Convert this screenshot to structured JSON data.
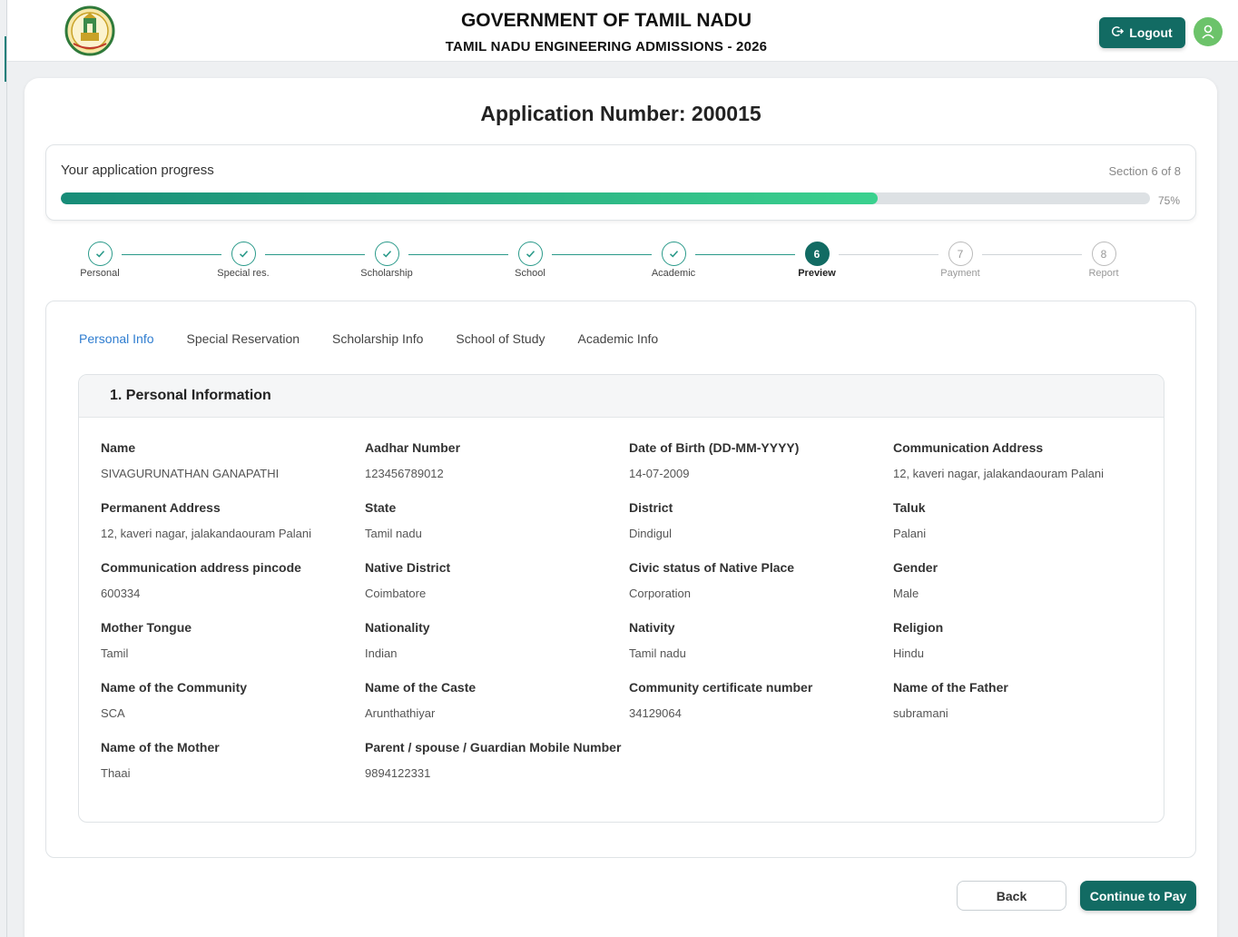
{
  "header": {
    "title": "GOVERNMENT OF TAMIL NADU",
    "subtitle": "TAMIL NADU ENGINEERING ADMISSIONS - 2026",
    "logout_label": "Logout"
  },
  "application": {
    "number_text": "Application Number: 200015"
  },
  "progress": {
    "label": "Your application progress",
    "section_text": "Section 6 of 8",
    "percent_text": "75%",
    "fraction": 0.75
  },
  "steps": [
    {
      "num": "1",
      "label": "Personal",
      "status": "done"
    },
    {
      "num": "2",
      "label": "Special res.",
      "status": "done"
    },
    {
      "num": "3",
      "label": "Scholarship",
      "status": "done"
    },
    {
      "num": "4",
      "label": "School",
      "status": "done"
    },
    {
      "num": "5",
      "label": "Academic",
      "status": "done"
    },
    {
      "num": "6",
      "label": "Preview",
      "status": "current"
    },
    {
      "num": "7",
      "label": "Payment",
      "status": "pending"
    },
    {
      "num": "8",
      "label": "Report",
      "status": "pending"
    }
  ],
  "tabs": [
    {
      "label": "Personal Info",
      "active": true
    },
    {
      "label": "Special Reservation",
      "active": false
    },
    {
      "label": "Scholarship Info",
      "active": false
    },
    {
      "label": "School of Study",
      "active": false
    },
    {
      "label": "Academic Info",
      "active": false
    }
  ],
  "section": {
    "title": "1. Personal Information",
    "fields": [
      {
        "label": "Name",
        "value": "SIVAGURUNATHAN GANAPATHI"
      },
      {
        "label": "Aadhar Number",
        "value": "123456789012"
      },
      {
        "label": "Date of Birth (DD-MM-YYYY)",
        "value": "14-07-2009"
      },
      {
        "label": "Communication Address",
        "value": "12, kaveri nagar, jalakandaouram Palani"
      },
      {
        "label": "Permanent Address",
        "value": "12, kaveri nagar, jalakandaouram Palani"
      },
      {
        "label": "State",
        "value": "Tamil nadu"
      },
      {
        "label": "District",
        "value": "Dindigul"
      },
      {
        "label": "Taluk",
        "value": "Palani"
      },
      {
        "label": "Communication address pincode",
        "value": "600334"
      },
      {
        "label": "Native District",
        "value": "Coimbatore"
      },
      {
        "label": "Civic status of Native Place",
        "value": "Corporation"
      },
      {
        "label": "Gender",
        "value": "Male"
      },
      {
        "label": "Mother Tongue",
        "value": "Tamil"
      },
      {
        "label": "Nationality",
        "value": "Indian"
      },
      {
        "label": "Nativity",
        "value": "Tamil nadu"
      },
      {
        "label": "Religion",
        "value": "Hindu"
      },
      {
        "label": "Name of the Community",
        "value": "SCA"
      },
      {
        "label": "Name of the Caste",
        "value": "Arunthathiyar"
      },
      {
        "label": "Community certificate number",
        "value": "34129064"
      },
      {
        "label": "Name of the Father",
        "value": "subramani"
      },
      {
        "label": "Name of the Mother",
        "value": "Thaai"
      },
      {
        "label": "Parent / spouse / Guardian Mobile Number",
        "value": "9894122331"
      }
    ]
  },
  "actions": {
    "back_label": "Back",
    "continue_label": "Continue to Pay"
  },
  "colors": {
    "primary": "#126b63",
    "progress_start": "#178c78",
    "progress_end": "#3ad18e",
    "tab_active": "#2f7dd0",
    "avatar": "#6cc36a"
  },
  "icons": {
    "logout": "logout-icon",
    "avatar": "user-icon",
    "step_done": "check-icon",
    "emblem": "tamil-nadu-emblem"
  }
}
